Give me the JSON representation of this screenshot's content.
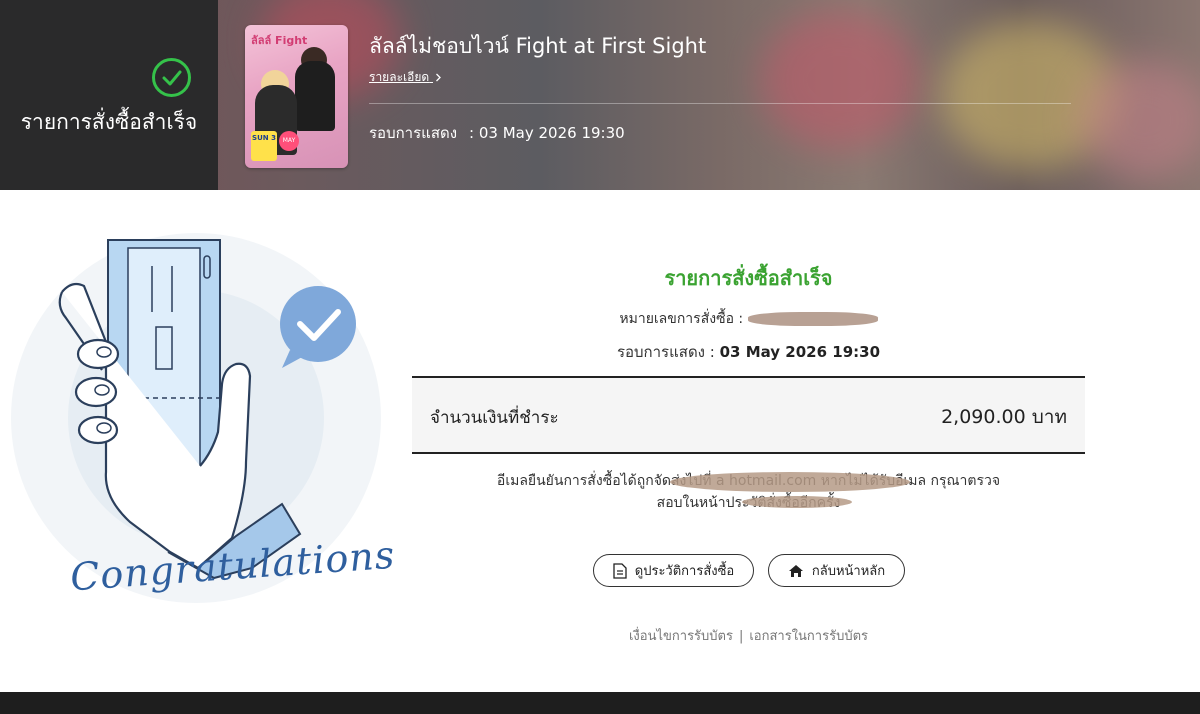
{
  "banner": {
    "status_text": "รายการสั่งซื้อสำเร็จ",
    "event_title": "ลัลล์ไม่ชอบไวน์ Fight at First Sight",
    "detail_link": "รายละเอียด",
    "showtime_label": "รอบการแสดง",
    "showtime_value": ": 03 May 2026 19:30",
    "poster": {
      "title_text": "ลัลล์ Fight",
      "date_day": "SUN 3",
      "date_month": "MAY"
    }
  },
  "illustration": {
    "caption": "Congratulations"
  },
  "main": {
    "heading": "รายการสั่งซื้อสำเร็จ",
    "order_label": "หมายเลขการสั่งซื้อ : ",
    "showtime_label": "รอบการแสดง : ",
    "showtime_value": "03 May 2026 19:30",
    "amount_label": "จำนวนเงินที่ชำระ",
    "amount_value": "2,090.00 บาท",
    "email_note_line1": "อีเมลยืนยันการสั่งซื้อได้ถูกจัดส่งไปที่ a                    hotmail.com หากไม่ได้รับอีเมล กรุณาตรวจ",
    "email_note_line2": "สอบในหน้าประวัติสั่งซื้ออีกครั้ง",
    "history_button": "ดูประวัติการสั่งซื้อ",
    "home_button": "กลับหน้าหลัก",
    "footer_link_1": "เงื่อนไขการรับบัตร",
    "footer_sep": "|",
    "footer_link_2": "เอกสารในการรับบัตร"
  },
  "colors": {
    "success_green": "#3ba332",
    "check_green": "#35c24a",
    "card_blue": "#b8d7f2",
    "caption_blue": "#2f5f9e"
  },
  "icons": {
    "check": "check-circle-icon",
    "chevron": "chevron-right-icon",
    "document": "document-icon",
    "home": "home-icon",
    "chat_check": "chat-check-icon"
  }
}
